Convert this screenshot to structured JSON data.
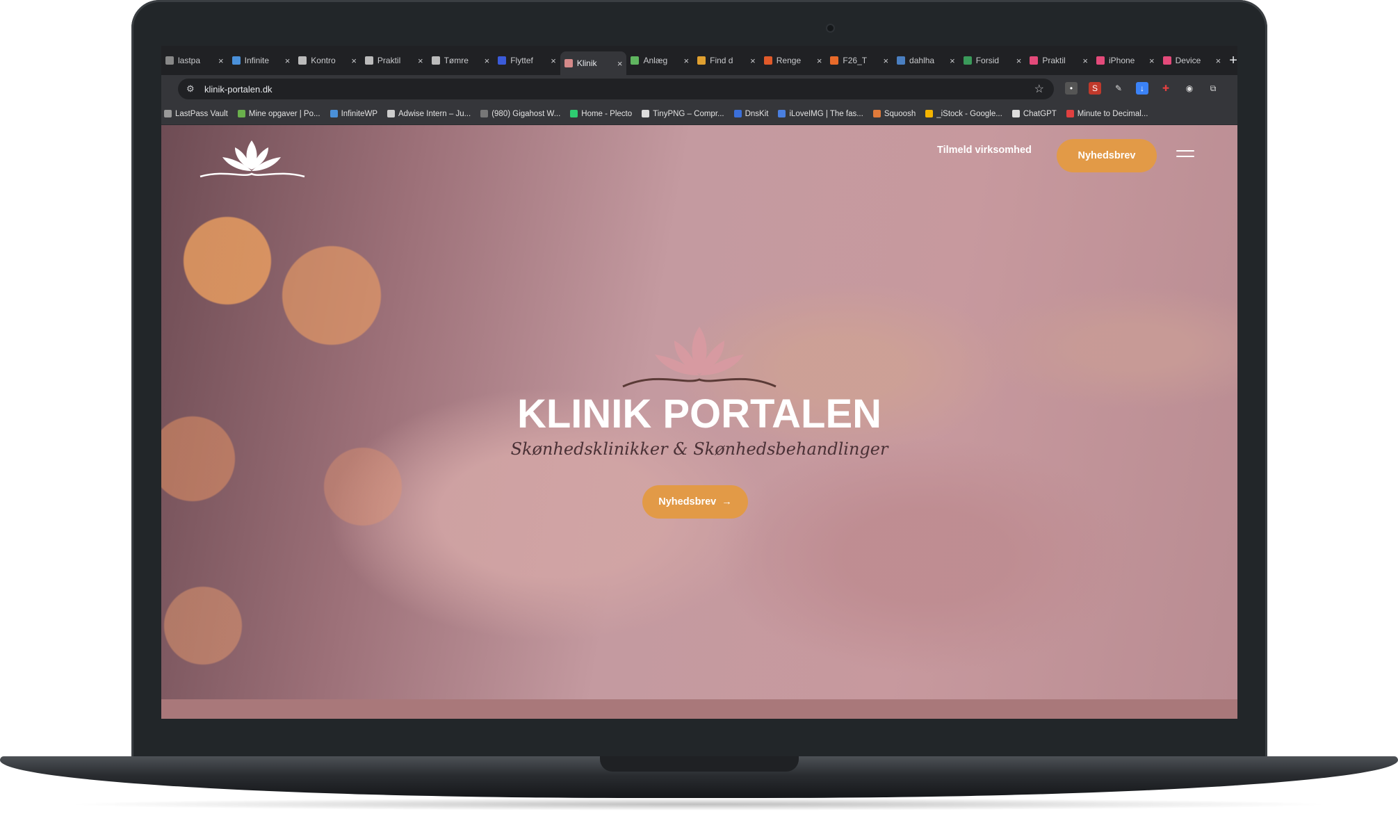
{
  "browser": {
    "tabs": [
      {
        "label": "lastpa",
        "icon": "lastpass-icon",
        "color": "#888888"
      },
      {
        "label": "Infinite",
        "icon": "infinity-icon",
        "color": "#4a90d9"
      },
      {
        "label": "Kontro",
        "icon": "a-letter-icon",
        "color": "#bbbbbb"
      },
      {
        "label": "Praktil",
        "icon": "globe-icon",
        "color": "#bbbbbb"
      },
      {
        "label": "Tømre",
        "icon": "circle-icon",
        "color": "#bbbbbb"
      },
      {
        "label": "Flyttef",
        "icon": "dots-icon",
        "color": "#3b5bd9"
      },
      {
        "label": "Klinik",
        "icon": "lotus-icon",
        "color": "#d58a8a"
      },
      {
        "label": "Anlæg",
        "icon": "leaf-icon",
        "color": "#5fb55f"
      },
      {
        "label": "Find d",
        "icon": "map-pin-icon",
        "color": "#e0a030"
      },
      {
        "label": "Renge",
        "icon": "24-icon",
        "color": "#e05a2a"
      },
      {
        "label": "F26_T",
        "icon": "square-icon",
        "color": "#e86a2a"
      },
      {
        "label": "dahlha",
        "icon": "wordpress-icon",
        "color": "#4a7fc1"
      },
      {
        "label": "Forsid",
        "icon": "leaf-icon",
        "color": "#3a9a5a"
      },
      {
        "label": "Praktil",
        "icon": "figma-icon",
        "color": "#e34a7a"
      },
      {
        "label": "iPhone",
        "icon": "figma-icon",
        "color": "#e34a7a"
      },
      {
        "label": "Device",
        "icon": "figma-icon",
        "color": "#e34a7a"
      }
    ],
    "new_tab": "+",
    "url": "klinik-portalen.dk",
    "bookmarks": [
      {
        "label": "LastPass Vault",
        "color": "#999999"
      },
      {
        "label": "Mine opgaver | Po...",
        "color": "#6ab04c"
      },
      {
        "label": "InfiniteWP",
        "color": "#4a90d9"
      },
      {
        "label": "Adwise Intern – Ju...",
        "color": "#cccccc"
      },
      {
        "label": "(980) Gigahost W...",
        "color": "#777777"
      },
      {
        "label": "Home - Plecto",
        "color": "#2ecc71"
      },
      {
        "label": "TinyPNG – Compr...",
        "color": "#dddddd"
      },
      {
        "label": "DnsKit",
        "color": "#3b6fd9"
      },
      {
        "label": "iLoveIMG | The fas...",
        "color": "#4a7fe0"
      },
      {
        "label": "Squoosh",
        "color": "#e07a3a"
      },
      {
        "label": "_iStock - Google...",
        "color": "#f4b400"
      },
      {
        "label": "ChatGPT",
        "color": "#dddddd"
      },
      {
        "label": "Minute to Decimal...",
        "color": "#e04040"
      }
    ]
  },
  "site": {
    "nav_link": "Tilmeld virksomhed",
    "nav_button": "Nyhedsbrev",
    "hero_title": "KLINIK PORTALEN",
    "hero_subtitle": "Skønhedsklinikker & Skønhedsbehandlinger",
    "hero_button": "Nyhedsbrev",
    "hero_button_arrow": "→",
    "accent": "#e29a47",
    "lotus_color": "#dca0a6"
  }
}
